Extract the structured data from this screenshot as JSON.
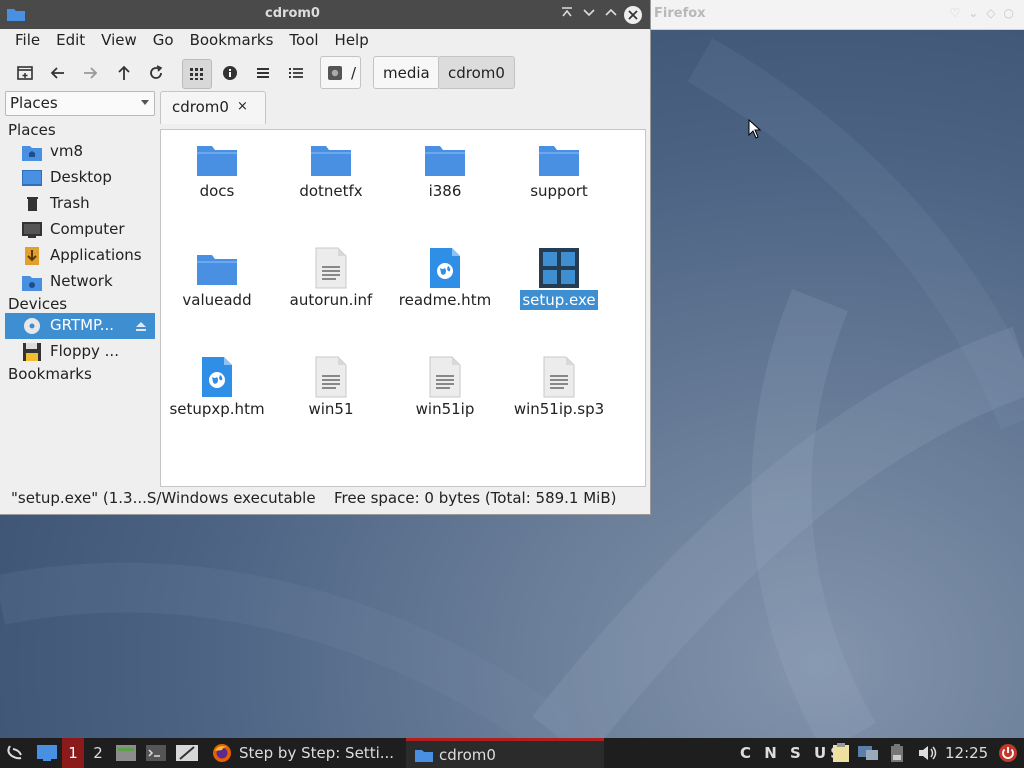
{
  "window": {
    "title": "cdrom0",
    "menu": [
      "File",
      "Edit",
      "View",
      "Go",
      "Bookmarks",
      "Tool",
      "Help"
    ],
    "path": [
      "/",
      "media",
      "cdrom0"
    ],
    "places_combo": "Places",
    "tab_label": "cdrom0",
    "tab_close": "×"
  },
  "sidebar": {
    "sections": {
      "places": "Places",
      "devices": "Devices",
      "bookmarks": "Bookmarks"
    },
    "places": [
      {
        "label": "vm8",
        "icon": "home-folder-icon"
      },
      {
        "label": "Desktop",
        "icon": "desktop-icon"
      },
      {
        "label": "Trash",
        "icon": "trash-icon"
      },
      {
        "label": "Computer",
        "icon": "computer-icon"
      },
      {
        "label": "Applications",
        "icon": "applications-icon"
      },
      {
        "label": "Network",
        "icon": "network-folder-icon"
      }
    ],
    "devices": [
      {
        "label": "GRTMP...",
        "icon": "cdrom-icon",
        "selected": true
      },
      {
        "label": "Floppy ...",
        "icon": "floppy-icon"
      }
    ]
  },
  "files": [
    {
      "name": "docs",
      "type": "folder"
    },
    {
      "name": "dotnetfx",
      "type": "folder"
    },
    {
      "name": "i386",
      "type": "folder"
    },
    {
      "name": "support",
      "type": "folder"
    },
    {
      "name": "valueadd",
      "type": "folder"
    },
    {
      "name": "autorun.inf",
      "type": "text"
    },
    {
      "name": "readme.htm",
      "type": "html"
    },
    {
      "name": "setup.exe",
      "type": "exe",
      "selected": true
    },
    {
      "name": "setupxp.htm",
      "type": "html"
    },
    {
      "name": "win51",
      "type": "text"
    },
    {
      "name": "win51ip",
      "type": "text"
    },
    {
      "name": "win51ip.sp3",
      "type": "text"
    }
  ],
  "status": {
    "left": "\"setup.exe\" (1.3...S/Windows executable",
    "right": "Free space: 0 bytes (Total: 589.1 MiB)"
  },
  "firefox_window": {
    "title": "Firefox"
  },
  "taskbar": {
    "workspaces": [
      "1",
      "2"
    ],
    "tasks": [
      {
        "label": "Step by Step: Setti...",
        "icon": "firefox-icon"
      },
      {
        "label": "cdrom0",
        "icon": "folder-icon",
        "active": true
      }
    ],
    "keyboard": "C N S US",
    "clock": "12:25"
  },
  "colors": {
    "accent": "#3d8fd1",
    "folder": "#4a90e2",
    "titlebar": "#4a4a4a",
    "taskbar": "#1e1e1e"
  }
}
